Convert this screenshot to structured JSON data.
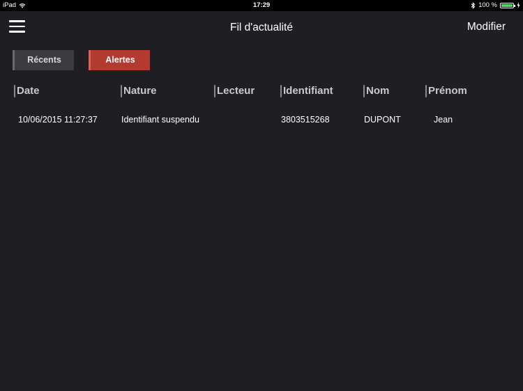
{
  "statusbar": {
    "device": "iPad",
    "time": "17:29",
    "battery_text": "100 %",
    "bluetooth_icon": "bluetooth-icon",
    "wifi_icon": "wifi-icon",
    "battery_color": "#4cd964"
  },
  "navbar": {
    "title": "Fil d'actualité",
    "right_button": "Modifier",
    "menu_icon": "hamburger-menu-icon"
  },
  "segments": {
    "recents_label": "Récents",
    "alertes_label": "Alertes",
    "selected": "Alertes",
    "selected_color": "#b33a2e"
  },
  "table": {
    "headers": [
      "Date",
      "Nature",
      "Lecteur",
      "Identifiant",
      "Nom",
      "Prénom"
    ],
    "rows": [
      [
        "10/06/2015 11:27:37",
        "Identifiant suspendu",
        "",
        "3803515268",
        "DUPONT",
        "Jean"
      ]
    ]
  }
}
